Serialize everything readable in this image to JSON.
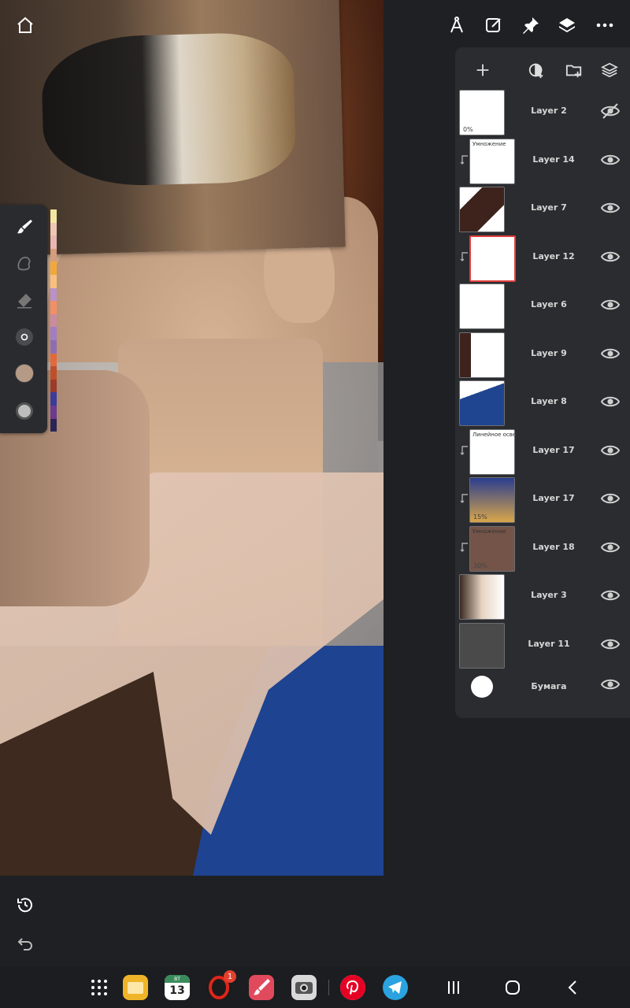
{
  "layers_panel": {
    "toolbar_icons": [
      "add-layer-icon",
      "fill-layer-icon",
      "new-folder-icon",
      "layers-stack-icon"
    ],
    "layers": [
      {
        "name": "Layer 2",
        "visible": false,
        "clipped": false,
        "thumb_note": "",
        "opacity_label": "0%"
      },
      {
        "name": "Layer 14",
        "visible": true,
        "clipped": true,
        "thumb_note": "Умножение",
        "opacity_label": ""
      },
      {
        "name": "Layer 7",
        "visible": true,
        "clipped": false,
        "thumb_note": "",
        "opacity_label": ""
      },
      {
        "name": "Layer 12",
        "visible": true,
        "clipped": true,
        "selected": true,
        "thumb_note": "",
        "opacity_label": ""
      },
      {
        "name": "Layer 6",
        "visible": true,
        "clipped": false,
        "thumb_note": "",
        "opacity_label": ""
      },
      {
        "name": "Layer 9",
        "visible": true,
        "clipped": false,
        "thumb_note": "",
        "opacity_label": ""
      },
      {
        "name": "Layer 8",
        "visible": true,
        "clipped": false,
        "thumb_note": "",
        "opacity_label": ""
      },
      {
        "name": "Layer 17",
        "visible": true,
        "clipped": true,
        "thumb_note": "Линейное осветление",
        "opacity_label": ""
      },
      {
        "name": "Layer 17",
        "visible": true,
        "clipped": true,
        "thumb_note": "",
        "opacity_label": "15%"
      },
      {
        "name": "Layer 18",
        "visible": true,
        "clipped": true,
        "thumb_note": "Умножение",
        "opacity_label": "30%"
      },
      {
        "name": "Layer 3",
        "visible": true,
        "clipped": false,
        "thumb_note": "",
        "opacity_label": ""
      },
      {
        "name": "Layer 11",
        "visible": true,
        "clipped": false,
        "thumb_note": "",
        "opacity_label": ""
      },
      {
        "name": "Бумага",
        "visible": true,
        "clipped": false,
        "thumb_note": "",
        "opacity_label": "",
        "is_paper": true
      }
    ]
  },
  "tools": {
    "current_color": "#b59a85",
    "palette": [
      "#f3e7a3",
      "#f0c7b6",
      "#e8b7b1",
      "#d49d7e",
      "#f2a93a",
      "#f7c07e",
      "#b992c9",
      "#f28f66",
      "#c98b9f",
      "#a17ec4",
      "#8d6fb1",
      "#e06a3c",
      "#bf4f2b",
      "#9b3b2a",
      "#3b3c9a",
      "#6c3b8e",
      "#2b2456"
    ]
  },
  "taskbar": {
    "calendar_day": "13",
    "calendar_dow": "ВТ",
    "opera_badge": "1"
  },
  "colors": {
    "panel_bg": "#2b2c2f",
    "selected_border": "#e0403f",
    "app_bg": "#1f2023"
  }
}
